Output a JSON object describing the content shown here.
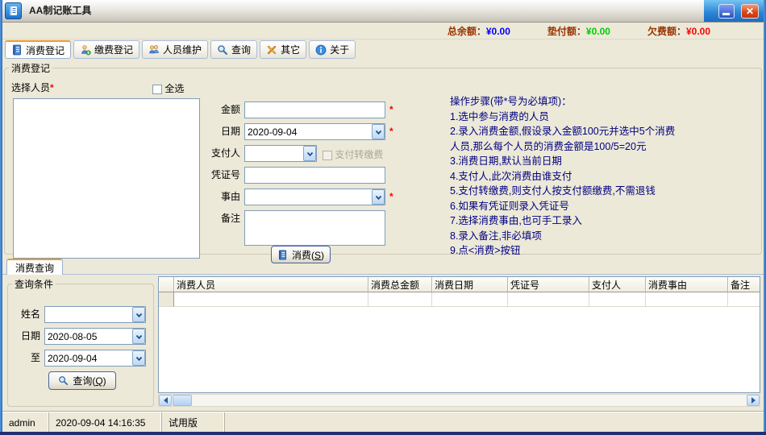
{
  "window": {
    "title": "AA制记账工具"
  },
  "summary": {
    "items": [
      {
        "label": "总余额：",
        "value": "¥0.00",
        "color": "#0000ff"
      },
      {
        "label": "垫付额：",
        "value": "¥0.00",
        "color": "#00cc00"
      },
      {
        "label": "欠费额：",
        "value": "¥0.00",
        "color": "#ff0000"
      }
    ]
  },
  "toolbar": {
    "tabs": [
      {
        "label": "消费登记",
        "icon": "notebook-icon",
        "active": true
      },
      {
        "label": "缴费登记",
        "icon": "payment-icon",
        "active": false
      },
      {
        "label": "人员维护",
        "icon": "people-icon",
        "active": false
      },
      {
        "label": "查询",
        "icon": "search-icon",
        "active": false
      },
      {
        "label": "其它",
        "icon": "tools-icon",
        "active": false
      },
      {
        "label": "关于",
        "icon": "info-icon",
        "active": false
      }
    ]
  },
  "consume_register": {
    "legend": "消费登记",
    "select_person_label": "选择人员",
    "required_marker": "*",
    "select_all_label": "全选",
    "amount_label": "金额",
    "date_label": "日期",
    "date_value": "2020-09-04",
    "payer_label": "支付人",
    "pay_transfer_label": "支付转缴费",
    "voucher_label": "凭证号",
    "reason_label": "事由",
    "remark_label": "备注",
    "consume_button": {
      "text": "消费(",
      "key": "S",
      "suffix": ")"
    },
    "instructions": [
      "操作步骤(带*号为必填项)：",
      "1.选中参与消费的人员",
      "2.录入消费金额,假设录入金额100元并选中5个消费",
      "人员,那么每个人员的消费金额是100/5=20元",
      "3.消费日期,默认当前日期",
      "4.支付人,此次消费由谁支付",
      "5.支付转缴费,则支付人按支付额缴费,不需退钱",
      "6.如果有凭证则录入凭证号",
      "7.选择消费事由,也可手工录入",
      "8.录入备注,非必填项",
      "9.点<消费>按钮"
    ]
  },
  "query": {
    "tab_label": "消费查询",
    "legend": "查询条件",
    "name_label": "姓名",
    "date_label": "日期",
    "date_from": "2020-08-05",
    "to_label": "至",
    "date_to": "2020-09-04",
    "query_button": {
      "text": "查询(",
      "key": "Q",
      "suffix": ")"
    },
    "table": {
      "columns": [
        "消费人员",
        "消费总金额",
        "消费日期",
        "凭证号",
        "支付人",
        "消费事由",
        "备注"
      ]
    }
  },
  "statusbar": {
    "user": "admin",
    "datetime": "2020-09-04 14:16:35",
    "edition": "试用版"
  }
}
